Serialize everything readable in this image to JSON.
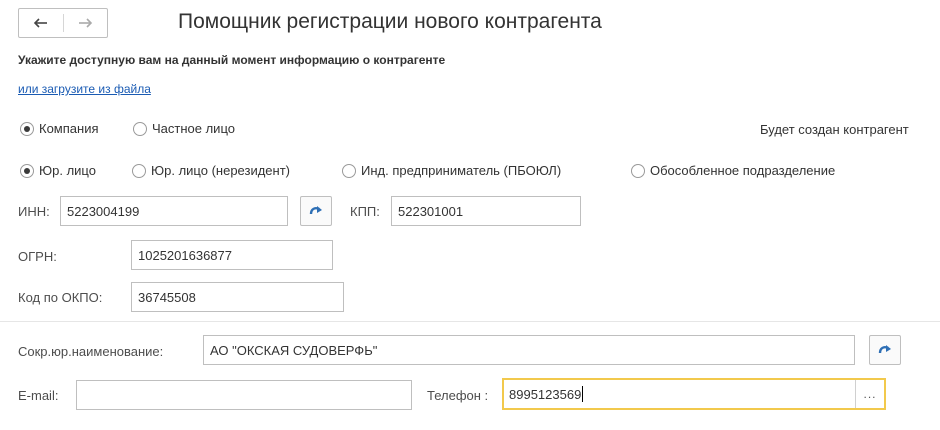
{
  "header": {
    "title": "Помощник регистрации нового контрагента",
    "subtitle": "Укажите доступную вам на данный момент информацию о контрагенте",
    "load_link": "или загрузите из файла"
  },
  "kind": {
    "options": [
      "Компания",
      "Частное лицо"
    ],
    "selected": "Компания",
    "result_note": "Будет создан контрагент"
  },
  "legal_form": {
    "options": [
      "Юр. лицо",
      "Юр. лицо (нерезидент)",
      "Инд. предприниматель (ПБОЮЛ)",
      "Обособленное подразделение"
    ],
    "selected": "Юр. лицо"
  },
  "fields": {
    "inn_label": "ИНН:",
    "inn_value": "5223004199",
    "kpp_label": "КПП:",
    "kpp_value": "522301001",
    "ogrn_label": "ОГРН:",
    "ogrn_value": "1025201636877",
    "okpo_label": "Код по ОКПО:",
    "okpo_value": "36745508",
    "short_name_label": "Сокр.юр.наименование:",
    "short_name_value": "АО \"ОКСКАЯ СУДОВЕРФЬ\"",
    "email_label": "E-mail:",
    "email_value": "",
    "phone_label": "Телефон :",
    "phone_value": "8995123569",
    "phone_more": "..."
  },
  "colors": {
    "accent_icon": "#2e6fb5",
    "link": "#1a5bb3",
    "active_border": "#f2c94c"
  },
  "icons": {
    "back": "arrow-left-icon",
    "forward": "arrow-right-icon",
    "fill": "curved-arrow-icon"
  }
}
